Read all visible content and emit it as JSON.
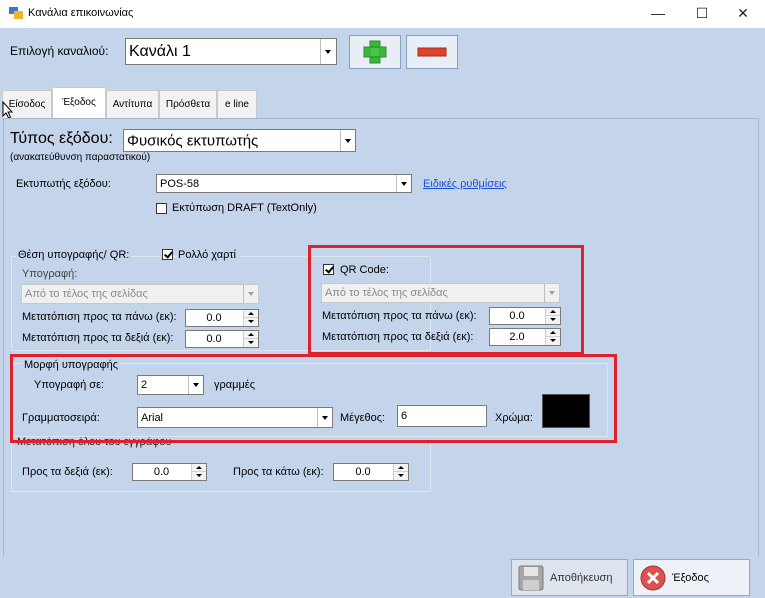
{
  "window": {
    "title": "Κανάλια επικοινωνίας",
    "controls": [
      "—",
      "☐",
      "✕"
    ]
  },
  "channel": {
    "label": "Επιλογή καναλιού:",
    "value": "Κανάλι 1"
  },
  "tabs": [
    "Είσοδος",
    "Έξοδος",
    "Αντίτυπα",
    "Πρόσθετα",
    "e line"
  ],
  "output": {
    "type_label": "Τύπος εξόδου:",
    "type_value": "Φυσικός εκτυπωτής",
    "type_sub": "(ανακατεύθυνση παραστατικού)",
    "printer_label": "Εκτυπωτής εξόδου:",
    "printer_value": "POS-58",
    "special_settings_link": "Ειδικές ρυθμίσεις",
    "draft_label": "Εκτύπωση DRAFT (TextOnly)"
  },
  "signature_position": {
    "group_title": "Θέση υπογραφής/ QR:",
    "roll_label": "Ρολλό χαρτί",
    "signature_label": "Υπογραφή:",
    "signature_value": "Από το τέλος της σελίδας",
    "offset_up_label": "Μετατόπιση προς τα πάνω (εκ):",
    "offset_up_value": "0.0",
    "offset_right_label": "Μετατόπιση προς τα δεξιά (εκ):",
    "offset_right_value": "0.0"
  },
  "qr": {
    "checkbox_label": "QR Code:",
    "position_value": "Από το τέλος της σελίδας",
    "offset_up_label": "Μετατόπιση προς τα πάνω (εκ):",
    "offset_up_value": "0.0",
    "offset_right_label": "Μετατόπιση προς τα δεξιά (εκ):",
    "offset_right_value": "2.0"
  },
  "signature_format": {
    "group_title": "Μορφή υπογραφής",
    "signature_in_label": "Υπογραφή σε:",
    "lines_value": "2",
    "lines_unit": "γραμμές",
    "font_label": "Γραμματοσειρά:",
    "font_value": "Arial",
    "size_label": "Μέγεθος:",
    "size_value": "6",
    "color_label": "Χρώμα:",
    "color_swatch": "#000000"
  },
  "document_offset": {
    "group_title": "Μετατόπιση όλου του εγγράφου",
    "right_label": "Προς τα δεξιά (εκ):",
    "right_value": "0.0",
    "down_label": "Προς τα κάτω (εκ):",
    "down_value": "0.0"
  },
  "footer": {
    "save_label": "Αποθήκευση",
    "exit_label": "Έξοδος"
  }
}
